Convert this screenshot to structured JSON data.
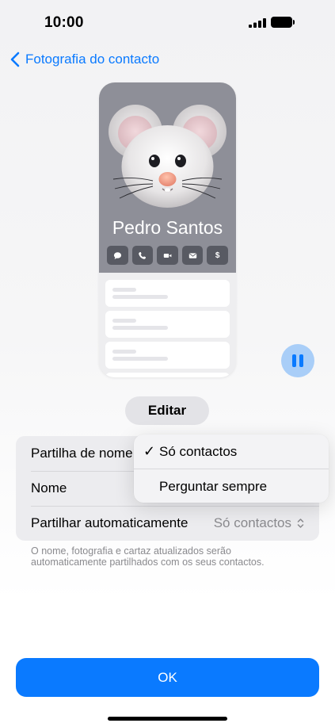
{
  "status_bar": {
    "time": "10:00"
  },
  "nav": {
    "back_label": "Fotografia do contacto"
  },
  "poster": {
    "name": "Pedro Santos",
    "background_color": "#8e8f98",
    "actions": [
      {
        "icon": "message-icon"
      },
      {
        "icon": "phone-icon"
      },
      {
        "icon": "video-icon"
      },
      {
        "icon": "mail-icon"
      },
      {
        "icon": "dollar-icon",
        "glyph": "$"
      }
    ]
  },
  "edit_button": {
    "label": "Editar"
  },
  "settings": {
    "rows": [
      {
        "label": "Partilha de nome"
      },
      {
        "label": "Nome"
      },
      {
        "label": "Partilhar automaticamente",
        "value": "Só contactos"
      }
    ],
    "footnote": "O nome, fotografia e cartaz atualizados serão automaticamente partilhados com os seus contactos."
  },
  "dropdown": {
    "check_glyph": "✓",
    "items": [
      {
        "label": "Só contactos",
        "selected": true
      },
      {
        "label": "Perguntar sempre",
        "selected": false
      }
    ]
  },
  "ok_button": {
    "label": "OK"
  },
  "colors": {
    "accent": "#0a7aff"
  }
}
